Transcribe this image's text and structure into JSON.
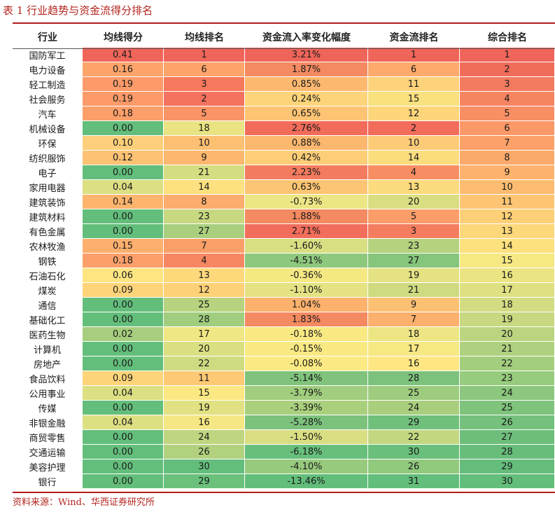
{
  "title": "表 1 行业趋势与资金流得分排名",
  "source": "资料来源：Wind、华西证券研究所",
  "columns": [
    "行业",
    "均线得分",
    "均线排名",
    "资金流入率变化幅度",
    "资金流排名",
    "综合排名"
  ],
  "rows": [
    {
      "industry": "国防军工",
      "score": "0.41",
      "ma_rank": "1",
      "change": "3.21%",
      "flow_rank": "1",
      "overall": "1",
      "c_score": "#f0655a",
      "c_ma": "#f0655a",
      "c_change": "#f0655a",
      "c_flow": "#f0655a",
      "c_overall": "#f0655a"
    },
    {
      "industry": "电力设备",
      "score": "0.16",
      "ma_rank": "6",
      "change": "1.87%",
      "flow_rank": "6",
      "overall": "2",
      "c_score": "#fda46b",
      "c_ma": "#fda46b",
      "c_change": "#f48a61",
      "c_flow": "#fdaa6c",
      "c_overall": "#f06c5b"
    },
    {
      "industry": "轻工制造",
      "score": "0.19",
      "ma_rank": "3",
      "change": "0.85%",
      "flow_rank": "11",
      "overall": "3",
      "c_score": "#fc9a69",
      "c_ma": "#f6795d",
      "c_change": "#fcb86e",
      "c_flow": "#fdd27b",
      "c_overall": "#f27b5f"
    },
    {
      "industry": "社会服务",
      "score": "0.19",
      "ma_rank": "2",
      "change": "0.24%",
      "flow_rank": "15",
      "overall": "4",
      "c_score": "#fc9a69",
      "c_ma": "#f37260",
      "c_change": "#fdd47a",
      "c_flow": "#fae17f",
      "c_overall": "#f58561"
    },
    {
      "industry": "汽车",
      "score": "0.18",
      "ma_rank": "5",
      "change": "0.65%",
      "flow_rank": "12",
      "overall": "5",
      "c_score": "#fc9f6a",
      "c_ma": "#f99467",
      "c_change": "#fdc473",
      "c_flow": "#fdd67b",
      "c_overall": "#f88f64"
    },
    {
      "industry": "机械设备",
      "score": "0.00",
      "ma_rank": "18",
      "change": "2.76%",
      "flow_rank": "2",
      "overall": "6",
      "c_score": "#63be7b",
      "c_ma": "#e9e383",
      "c_change": "#f26c5b",
      "c_flow": "#f26c5b",
      "c_overall": "#fa9867"
    },
    {
      "industry": "环保",
      "score": "0.10",
      "ma_rank": "10",
      "change": "0.88%",
      "flow_rank": "10",
      "overall": "7",
      "c_score": "#fecf7a",
      "c_ma": "#fdc072",
      "c_change": "#fcb76e",
      "c_flow": "#fdcb77",
      "c_overall": "#fba169"
    },
    {
      "industry": "纺织服饰",
      "score": "0.12",
      "ma_rank": "9",
      "change": "0.42%",
      "flow_rank": "14",
      "overall": "8",
      "c_score": "#fdc273",
      "c_ma": "#fdb76f",
      "c_change": "#fdcd77",
      "c_flow": "#fcdd7e",
      "c_overall": "#fcaa6c"
    },
    {
      "industry": "电子",
      "score": "0.00",
      "ma_rank": "21",
      "change": "2.23%",
      "flow_rank": "4",
      "overall": "9",
      "c_score": "#63be7b",
      "c_ma": "#d5dd82",
      "c_change": "#f37b5f",
      "c_flow": "#f78d63",
      "c_overall": "#fdb36e"
    },
    {
      "industry": "家用电器",
      "score": "0.04",
      "ma_rank": "14",
      "change": "0.63%",
      "flow_rank": "13",
      "overall": "10",
      "c_score": "#dcdf82",
      "c_ma": "#fde07f",
      "c_change": "#fdc573",
      "c_flow": "#fbdb7d",
      "c_overall": "#fdbc71"
    },
    {
      "industry": "建筑装饰",
      "score": "0.14",
      "ma_rank": "8",
      "change": "-0.73%",
      "flow_rank": "20",
      "overall": "11",
      "c_score": "#fdb56e",
      "c_ma": "#fdad6d",
      "c_change": "#ece684",
      "c_flow": "#d9de82",
      "c_overall": "#fdc573"
    },
    {
      "industry": "建筑材料",
      "score": "0.00",
      "ma_rank": "23",
      "change": "1.88%",
      "flow_rank": "5",
      "overall": "12",
      "c_score": "#63be7b",
      "c_ma": "#c7d881",
      "c_change": "#f48a61",
      "c_flow": "#fa9d69",
      "c_overall": "#fdcf77"
    },
    {
      "industry": "有色金属",
      "score": "0.00",
      "ma_rank": "27",
      "change": "2.71%",
      "flow_rank": "3",
      "overall": "13",
      "c_score": "#63be7b",
      "c_ma": "#a9cf7e",
      "c_change": "#f26d5b",
      "c_flow": "#f47d5f",
      "c_overall": "#fdd87b"
    },
    {
      "industry": "农林牧渔",
      "score": "0.15",
      "ma_rank": "7",
      "change": "-1.60%",
      "flow_rank": "23",
      "overall": "14",
      "c_score": "#fdaf6d",
      "c_ma": "#fb9f69",
      "c_change": "#d8de82",
      "c_flow": "#b5d27f",
      "c_overall": "#fde17f"
    },
    {
      "industry": "钢铁",
      "score": "0.18",
      "ma_rank": "4",
      "change": "-4.51%",
      "flow_rank": "27",
      "overall": "15",
      "c_score": "#fc9f6a",
      "c_ma": "#f78762",
      "c_change": "#8ec87d",
      "c_flow": "#86c57c",
      "c_overall": "#f6e883"
    },
    {
      "industry": "石油石化",
      "score": "0.06",
      "ma_rank": "13",
      "change": "-0.36%",
      "flow_rank": "19",
      "overall": "16",
      "c_score": "#fde582",
      "c_ma": "#fdd97c",
      "c_change": "#f4e883",
      "c_flow": "#e4e283",
      "c_overall": "#ebe483"
    },
    {
      "industry": "煤炭",
      "score": "0.09",
      "ma_rank": "12",
      "change": "-1.10%",
      "flow_rank": "21",
      "overall": "17",
      "c_score": "#fed47b",
      "c_ma": "#fdd177",
      "c_change": "#e4e283",
      "c_flow": "#cfda81",
      "c_overall": "#dfe082"
    },
    {
      "industry": "通信",
      "score": "0.00",
      "ma_rank": "25",
      "change": "1.04%",
      "flow_rank": "9",
      "overall": "18",
      "c_score": "#63be7b",
      "c_ma": "#b8d37f",
      "c_change": "#fcb16d",
      "c_flow": "#fcc073",
      "c_overall": "#d3dc82"
    },
    {
      "industry": "基础化工",
      "score": "0.00",
      "ma_rank": "28",
      "change": "1.83%",
      "flow_rank": "7",
      "overall": "19",
      "c_score": "#63be7b",
      "c_ma": "#a0cd7e",
      "c_change": "#f48a61",
      "c_flow": "#fcb06d",
      "c_overall": "#c7d881"
    },
    {
      "industry": "医药生物",
      "score": "0.02",
      "ma_rank": "17",
      "change": "-0.18%",
      "flow_rank": "18",
      "overall": "20",
      "c_score": "#a6ce7e",
      "c_ma": "#f0e683",
      "c_change": "#f8e983",
      "c_flow": "#ede584",
      "c_overall": "#bbd47f"
    },
    {
      "industry": "计算机",
      "score": "0.00",
      "ma_rank": "20",
      "change": "-0.15%",
      "flow_rank": "17",
      "overall": "21",
      "c_score": "#63be7b",
      "c_ma": "#dadf82",
      "c_change": "#f9e983",
      "c_flow": "#f6e883",
      "c_overall": "#afd17f"
    },
    {
      "industry": "房地产",
      "score": "0.00",
      "ma_rank": "22",
      "change": "-0.08%",
      "flow_rank": "16",
      "overall": "22",
      "c_score": "#63be7b",
      "c_ma": "#cfdb81",
      "c_change": "#fbea83",
      "c_flow": "#fee683",
      "c_overall": "#a3ce7e"
    },
    {
      "industry": "食品饮料",
      "score": "0.09",
      "ma_rank": "11",
      "change": "-5.14%",
      "flow_rank": "28",
      "overall": "23",
      "c_score": "#fed47b",
      "c_ma": "#fdc975",
      "c_change": "#80c37c",
      "c_flow": "#7cc27c",
      "c_overall": "#97cb7d"
    },
    {
      "industry": "公用事业",
      "score": "0.04",
      "ma_rank": "15",
      "change": "-3.79%",
      "flow_rank": "25",
      "overall": "24",
      "c_score": "#dcdf82",
      "c_ma": "#fbe882",
      "c_change": "#a1cd7e",
      "c_flow": "#9dcc7e",
      "c_overall": "#8bc77d"
    },
    {
      "industry": "传媒",
      "score": "0.00",
      "ma_rank": "19",
      "change": "-3.39%",
      "flow_rank": "24",
      "overall": "25",
      "c_score": "#63be7b",
      "c_ma": "#e1e183",
      "c_change": "#aad07e",
      "c_flow": "#a9cf7e",
      "c_overall": "#7fc37c"
    },
    {
      "industry": "非银金融",
      "score": "0.04",
      "ma_rank": "16",
      "change": "-5.28%",
      "flow_rank": "29",
      "overall": "26",
      "c_score": "#dcdf82",
      "c_ma": "#f5e783",
      "c_change": "#7cc27c",
      "c_flow": "#70c07c",
      "c_overall": "#74c07c"
    },
    {
      "industry": "商贸零售",
      "score": "0.00",
      "ma_rank": "24",
      "change": "-1.50%",
      "flow_rank": "22",
      "overall": "27",
      "c_score": "#63be7b",
      "c_ma": "#bfd580",
      "c_change": "#d9de82",
      "c_flow": "#c3d780",
      "c_overall": "#6ebe7b"
    },
    {
      "industry": "交通运输",
      "score": "0.00",
      "ma_rank": "26",
      "change": "-6.18%",
      "flow_rank": "30",
      "overall": "28",
      "c_score": "#63be7b",
      "c_ma": "#b2d17f",
      "c_change": "#67bf7b",
      "c_flow": "#69bf7b",
      "c_overall": "#68bd7b"
    },
    {
      "industry": "美容护理",
      "score": "0.00",
      "ma_rank": "30",
      "change": "-4.10%",
      "flow_rank": "26",
      "overall": "29",
      "c_score": "#63be7b",
      "c_ma": "#63be7b",
      "c_change": "#97ca7d",
      "c_flow": "#91c97d",
      "c_overall": "#64bd7b"
    },
    {
      "industry": "银行",
      "score": "0.00",
      "ma_rank": "29",
      "change": "-13.46%",
      "flow_rank": "31",
      "overall": "30",
      "c_score": "#63be7b",
      "c_ma": "#6bc07b",
      "c_change": "#63be7b",
      "c_flow": "#63be7b",
      "c_overall": "#63be7b"
    }
  ]
}
